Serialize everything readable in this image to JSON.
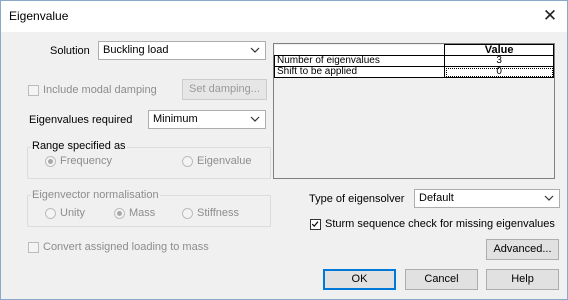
{
  "window": {
    "title": "Eigenvalue",
    "close_glyph": "✕"
  },
  "solution": {
    "label": "Solution",
    "value": "Buckling load"
  },
  "modal_damping": {
    "label": "Include modal damping",
    "checked": false,
    "enabled": false
  },
  "set_damping_button": "Set damping...",
  "eigenvalues_required": {
    "label": "Eigenvalues required",
    "value": "Minimum"
  },
  "range_group": {
    "legend": "Range specified as",
    "options": [
      {
        "label": "Frequency",
        "selected": true
      },
      {
        "label": "Eigenvalue",
        "selected": false
      }
    ]
  },
  "normalisation_group": {
    "legend": "Eigenvector normalisation",
    "options": [
      {
        "label": "Unity",
        "selected": false
      },
      {
        "label": "Mass",
        "selected": true
      },
      {
        "label": "Stiffness",
        "selected": false
      }
    ]
  },
  "convert_loading": {
    "label": "Convert assigned loading to mass",
    "checked": false,
    "enabled": false
  },
  "grid": {
    "header": "Value",
    "rows": [
      {
        "name": "Number of eigenvalues",
        "value": "3"
      },
      {
        "name": "Shift to be applied",
        "value": "0"
      }
    ]
  },
  "eigensolver": {
    "label": "Type of eigensolver",
    "value": "Default"
  },
  "sturm": {
    "label": "Sturm sequence check for missing eigenvalues",
    "checked": true
  },
  "buttons": {
    "advanced": "Advanced...",
    "ok": "OK",
    "cancel": "Cancel",
    "help": "Help"
  },
  "colors": {
    "accent": "#0078d7",
    "disabled_text": "#8d8d8d",
    "dialog_bg": "#f0f0f0"
  }
}
